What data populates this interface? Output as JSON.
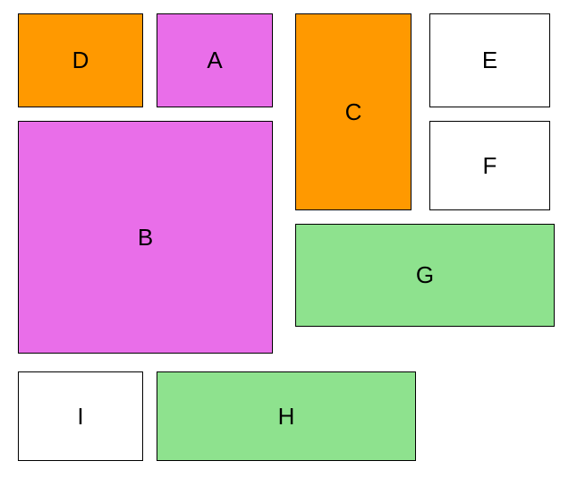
{
  "blocks": {
    "d": {
      "label": "D",
      "color": "#ff9900"
    },
    "a": {
      "label": "A",
      "color": "#e96ee9"
    },
    "c": {
      "label": "C",
      "color": "#ff9900"
    },
    "e": {
      "label": "E",
      "color": "#ffffff"
    },
    "f": {
      "label": "F",
      "color": "#ffffff"
    },
    "b": {
      "label": "B",
      "color": "#e96ee9"
    },
    "g": {
      "label": "G",
      "color": "#8ee28e"
    },
    "i": {
      "label": "I",
      "color": "#ffffff"
    },
    "h": {
      "label": "H",
      "color": "#8ee28e"
    }
  }
}
